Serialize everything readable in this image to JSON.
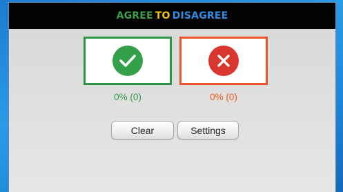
{
  "title": {
    "part1": "AGREE",
    "part2": "TO",
    "part3": "DISAGREE"
  },
  "agree": {
    "icon": "check-icon",
    "percent_label": "0% (0)"
  },
  "disagree": {
    "icon": "cross-icon",
    "percent_label": "0% (0)"
  },
  "buttons": {
    "clear_label": "Clear",
    "settings_label": "Settings"
  },
  "colors": {
    "agree": "#2e9448",
    "disagree": "#e8562a",
    "title_agree": "#3aa04a",
    "title_to": "#f2c400",
    "title_disagree": "#2f8de4"
  }
}
